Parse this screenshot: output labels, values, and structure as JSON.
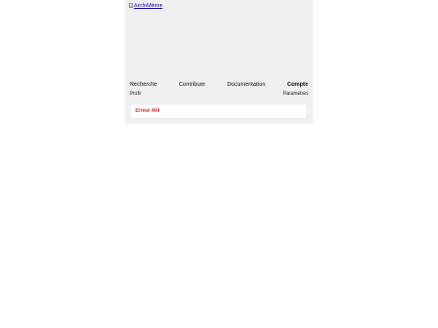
{
  "logo": {
    "alt_text": "ArchiMème"
  },
  "nav": {
    "main": [
      {
        "label": "Recherche"
      },
      {
        "label": "Contribuer"
      },
      {
        "label": "Documentation"
      },
      {
        "label": "Compte"
      }
    ],
    "sub": [
      {
        "label": "Profil"
      },
      {
        "label": "Paramètres"
      }
    ]
  },
  "error": {
    "message": "Erreur 404"
  },
  "colors": {
    "page_background": "#f0f0f0",
    "error_text": "#d42020",
    "link": "#1a0dab"
  }
}
